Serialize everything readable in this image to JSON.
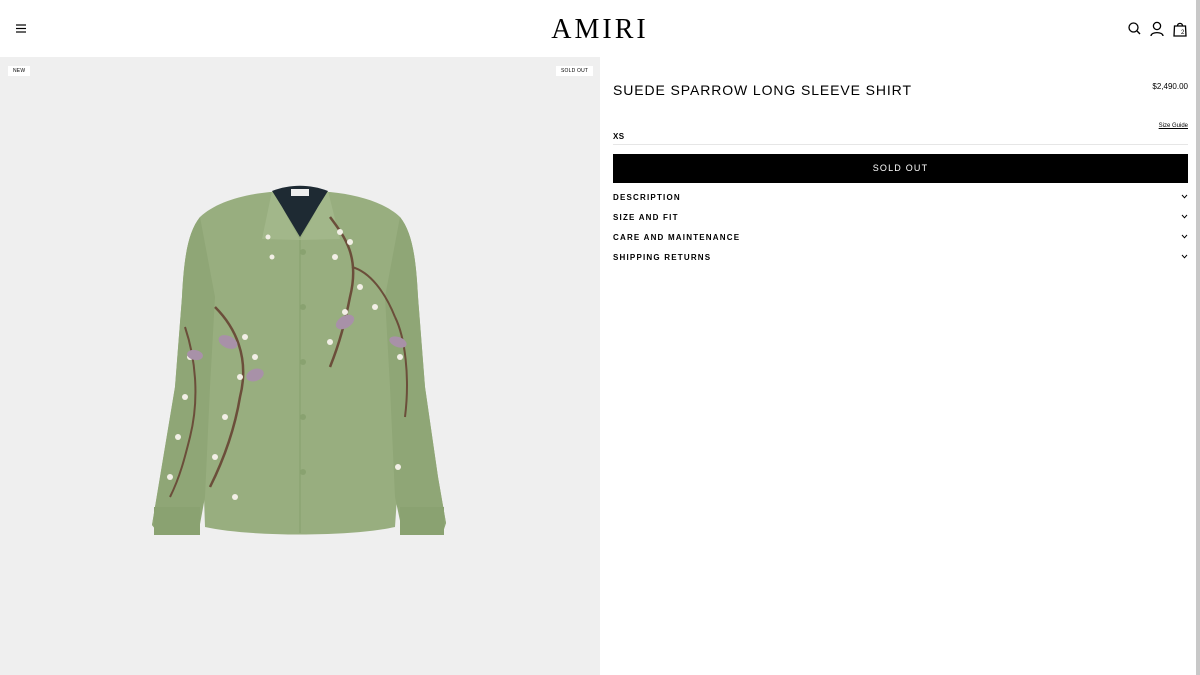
{
  "header": {
    "logo_text": "AMIRI",
    "menu_icon": "hamburger-menu-icon",
    "search_icon": "search-icon",
    "account_icon": "user-icon",
    "bag_icon": "shopping-bag-icon",
    "bag_count": "2"
  },
  "gallery": {
    "badge_new": "NEW",
    "badge_sold_out": "SOLD OUT"
  },
  "product": {
    "title": "SUEDE SPARROW LONG SLEEVE SHIRT",
    "price": "$2,490.00",
    "size_guide_label": "Size Guide",
    "selected_size": "XS",
    "sold_out_button": "SOLD OUT"
  },
  "accordions": [
    {
      "label": "DESCRIPTION",
      "icon": "chevron-down-icon"
    },
    {
      "label": "SIZE AND FIT",
      "icon": "chevron-down-icon"
    },
    {
      "label": "CARE AND MAINTENANCE",
      "icon": "chevron-down-icon"
    },
    {
      "label": "SHIPPING RETURNS",
      "icon": "chevron-down-icon"
    }
  ],
  "colors": {
    "panel_background": "#efefef",
    "shirt_green": "#98ae7f",
    "button_background": "#000000"
  }
}
